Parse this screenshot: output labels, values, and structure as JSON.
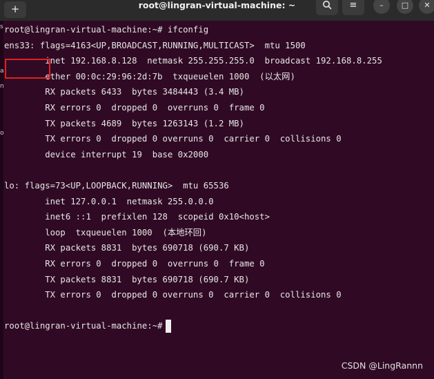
{
  "window": {
    "title": "root@lingran-virtual-machine: ~",
    "new_tab_glyph": "+",
    "search_glyph": "🔍",
    "menu_glyph": "≡",
    "minimize_glyph": "–",
    "maximize_glyph": "□",
    "close_glyph": "✕"
  },
  "left_edge_fragments": [
    "s",
    "a",
    "n",
    "o"
  ],
  "terminal": {
    "lines": [
      "root@lingran-virtual-machine:~# ifconfig",
      "ens33: flags=4163<UP,BROADCAST,RUNNING,MULTICAST>  mtu 1500",
      "        inet 192.168.8.128  netmask 255.255.255.0  broadcast 192.168.8.255",
      "        ether 00:0c:29:96:2d:7b  txqueuelen 1000  (以太网)",
      "        RX packets 6433  bytes 3484443 (3.4 MB)",
      "        RX errors 0  dropped 0  overruns 0  frame 0",
      "        TX packets 4689  bytes 1263143 (1.2 MB)",
      "        TX errors 0  dropped 0 overruns 0  carrier 0  collisions 0",
      "        device interrupt 19  base 0x2000",
      "",
      "lo: flags=73<UP,LOOPBACK,RUNNING>  mtu 65536",
      "        inet 127.0.0.1  netmask 255.0.0.0",
      "        inet6 ::1  prefixlen 128  scopeid 0x10<host>",
      "        loop  txqueuelen 1000  (本地环回)",
      "        RX packets 8831  bytes 690718 (690.7 KB)",
      "        RX errors 0  dropped 0  overruns 0  frame 0",
      "        TX packets 8831  bytes 690718 (690.7 KB)",
      "        TX errors 0  dropped 0 overruns 0  carrier 0  collisions 0",
      "",
      "root@lingran-virtual-machine:~#"
    ]
  },
  "watermark": "CSDN @LingRannn",
  "colors": {
    "terminal_bg": "#300a24",
    "terminal_fg": "#e6e6e6",
    "titlebar_bg": "#2b2b2b",
    "highlight_border": "#e02020"
  }
}
